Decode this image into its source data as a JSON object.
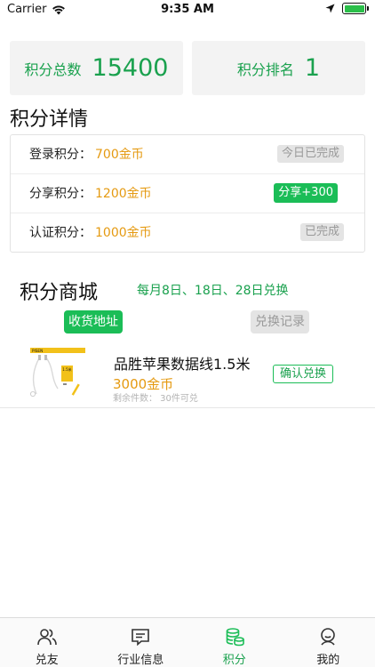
{
  "status_bar": {
    "carrier": "Carrier",
    "time": "9:35 AM",
    "battery_level": 1.0
  },
  "stats": {
    "total_label": "积分总数",
    "total_value": "15400",
    "rank_label": "积分排名",
    "rank_value": "1"
  },
  "details": {
    "title": "积分详情",
    "rows": [
      {
        "label": "登录积分：",
        "value": "700金币",
        "badge": "今日已完成"
      },
      {
        "label": "分享积分：",
        "value": "1200金币",
        "badge": "分享+300"
      },
      {
        "label": "认证积分：",
        "value": "1000金币",
        "badge": "已完成"
      }
    ]
  },
  "shop": {
    "title": "积分商城",
    "note": "每月8日、18日、28日兑换",
    "address_button": "收货地址",
    "records_button": "兑换记录",
    "product": {
      "name": "品胜苹果数据线1.5米",
      "price": "3000金币",
      "stock": "剩余件数： 30件可兑",
      "confirm_button": "确认兑换",
      "image_brand": "PISEN",
      "image_tag": "1.5米"
    }
  },
  "tabs": [
    {
      "label": "兑友",
      "icon": "friends-icon"
    },
    {
      "label": "行业信息",
      "icon": "news-icon"
    },
    {
      "label": "积分",
      "icon": "coins-icon",
      "active": true
    },
    {
      "label": "我的",
      "icon": "profile-icon"
    }
  ],
  "colors": {
    "accent": "#1bbd57",
    "accent_text": "#1aa14e",
    "price": "#e59a11",
    "disabled_bg": "#e4e4e4",
    "disabled_text": "#9a9a9a"
  }
}
